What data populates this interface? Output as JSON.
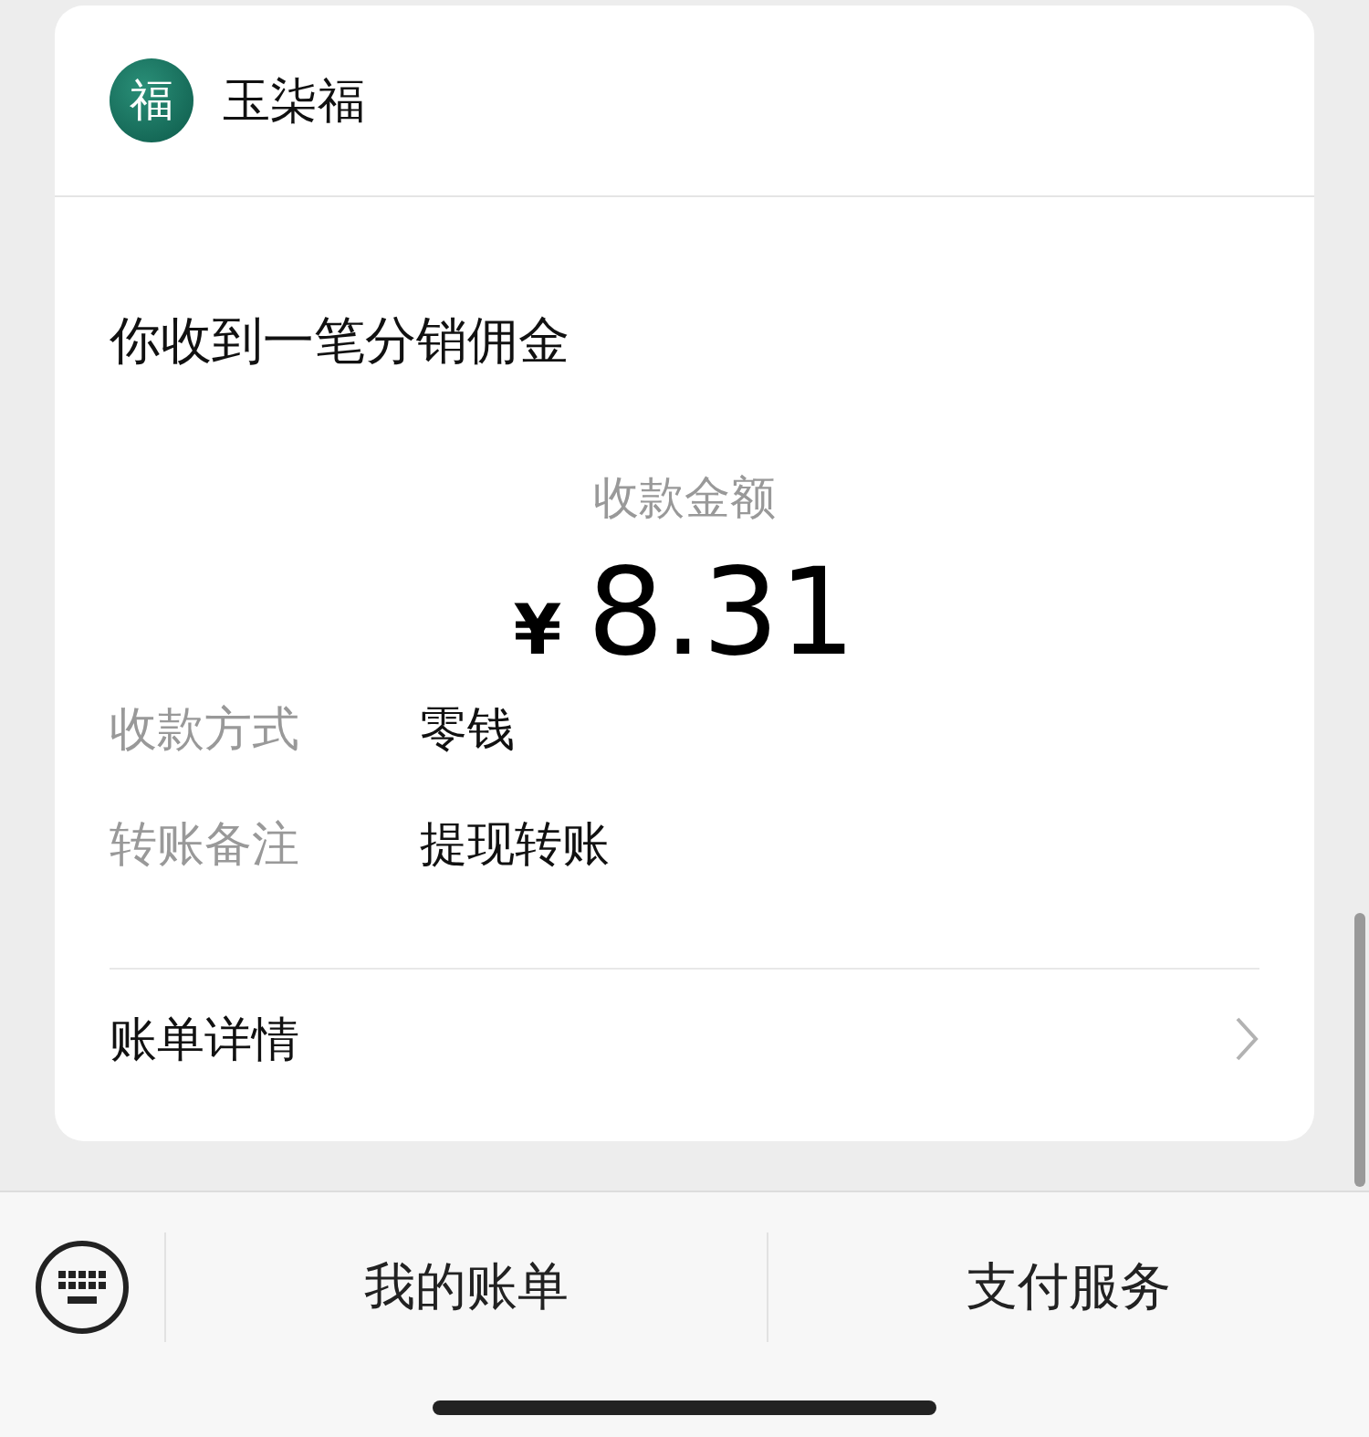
{
  "account": {
    "logo": "福",
    "name": "玉柒福"
  },
  "message": {
    "title": "你收到一笔分销佣金",
    "amount_label": "收款金额",
    "currency": "¥",
    "amount": "8.31",
    "fields": [
      {
        "label": "收款方式",
        "value": "零钱"
      },
      {
        "label": "转账备注",
        "value": "提现转账"
      }
    ],
    "details_link": "账单详情"
  },
  "bottom_bar": {
    "buttons": [
      "我的账单",
      "支付服务"
    ]
  }
}
